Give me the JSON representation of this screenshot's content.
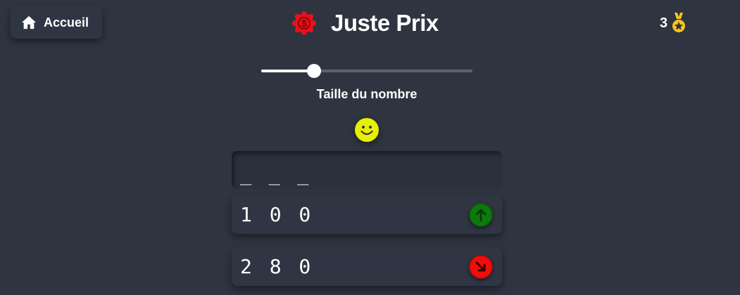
{
  "header": {
    "home_label": "Accueil",
    "title": "Juste Prix",
    "score": "3",
    "icons": {
      "home": "home-icon",
      "badge": "dollar-badge-icon",
      "medal": "medal-icon"
    }
  },
  "slider": {
    "label": "Taille du nombre",
    "level_fraction": 0.25
  },
  "mood": {
    "icon": "smiley-face-icon",
    "color": "#e6f000"
  },
  "input": {
    "placeholder": "_ _ _"
  },
  "guesses": [
    {
      "value": "1 0 0",
      "hint": "higher",
      "icon": "arrow-up-icon",
      "color": "#0d7a0d"
    },
    {
      "value": "2 8 0",
      "hint": "lower",
      "icon": "arrow-down-right-icon",
      "color": "#f20d0d"
    }
  ],
  "colors": {
    "background": "#2e3440",
    "badge_red": "#e8111b",
    "medal_gold": "#f5c518"
  }
}
